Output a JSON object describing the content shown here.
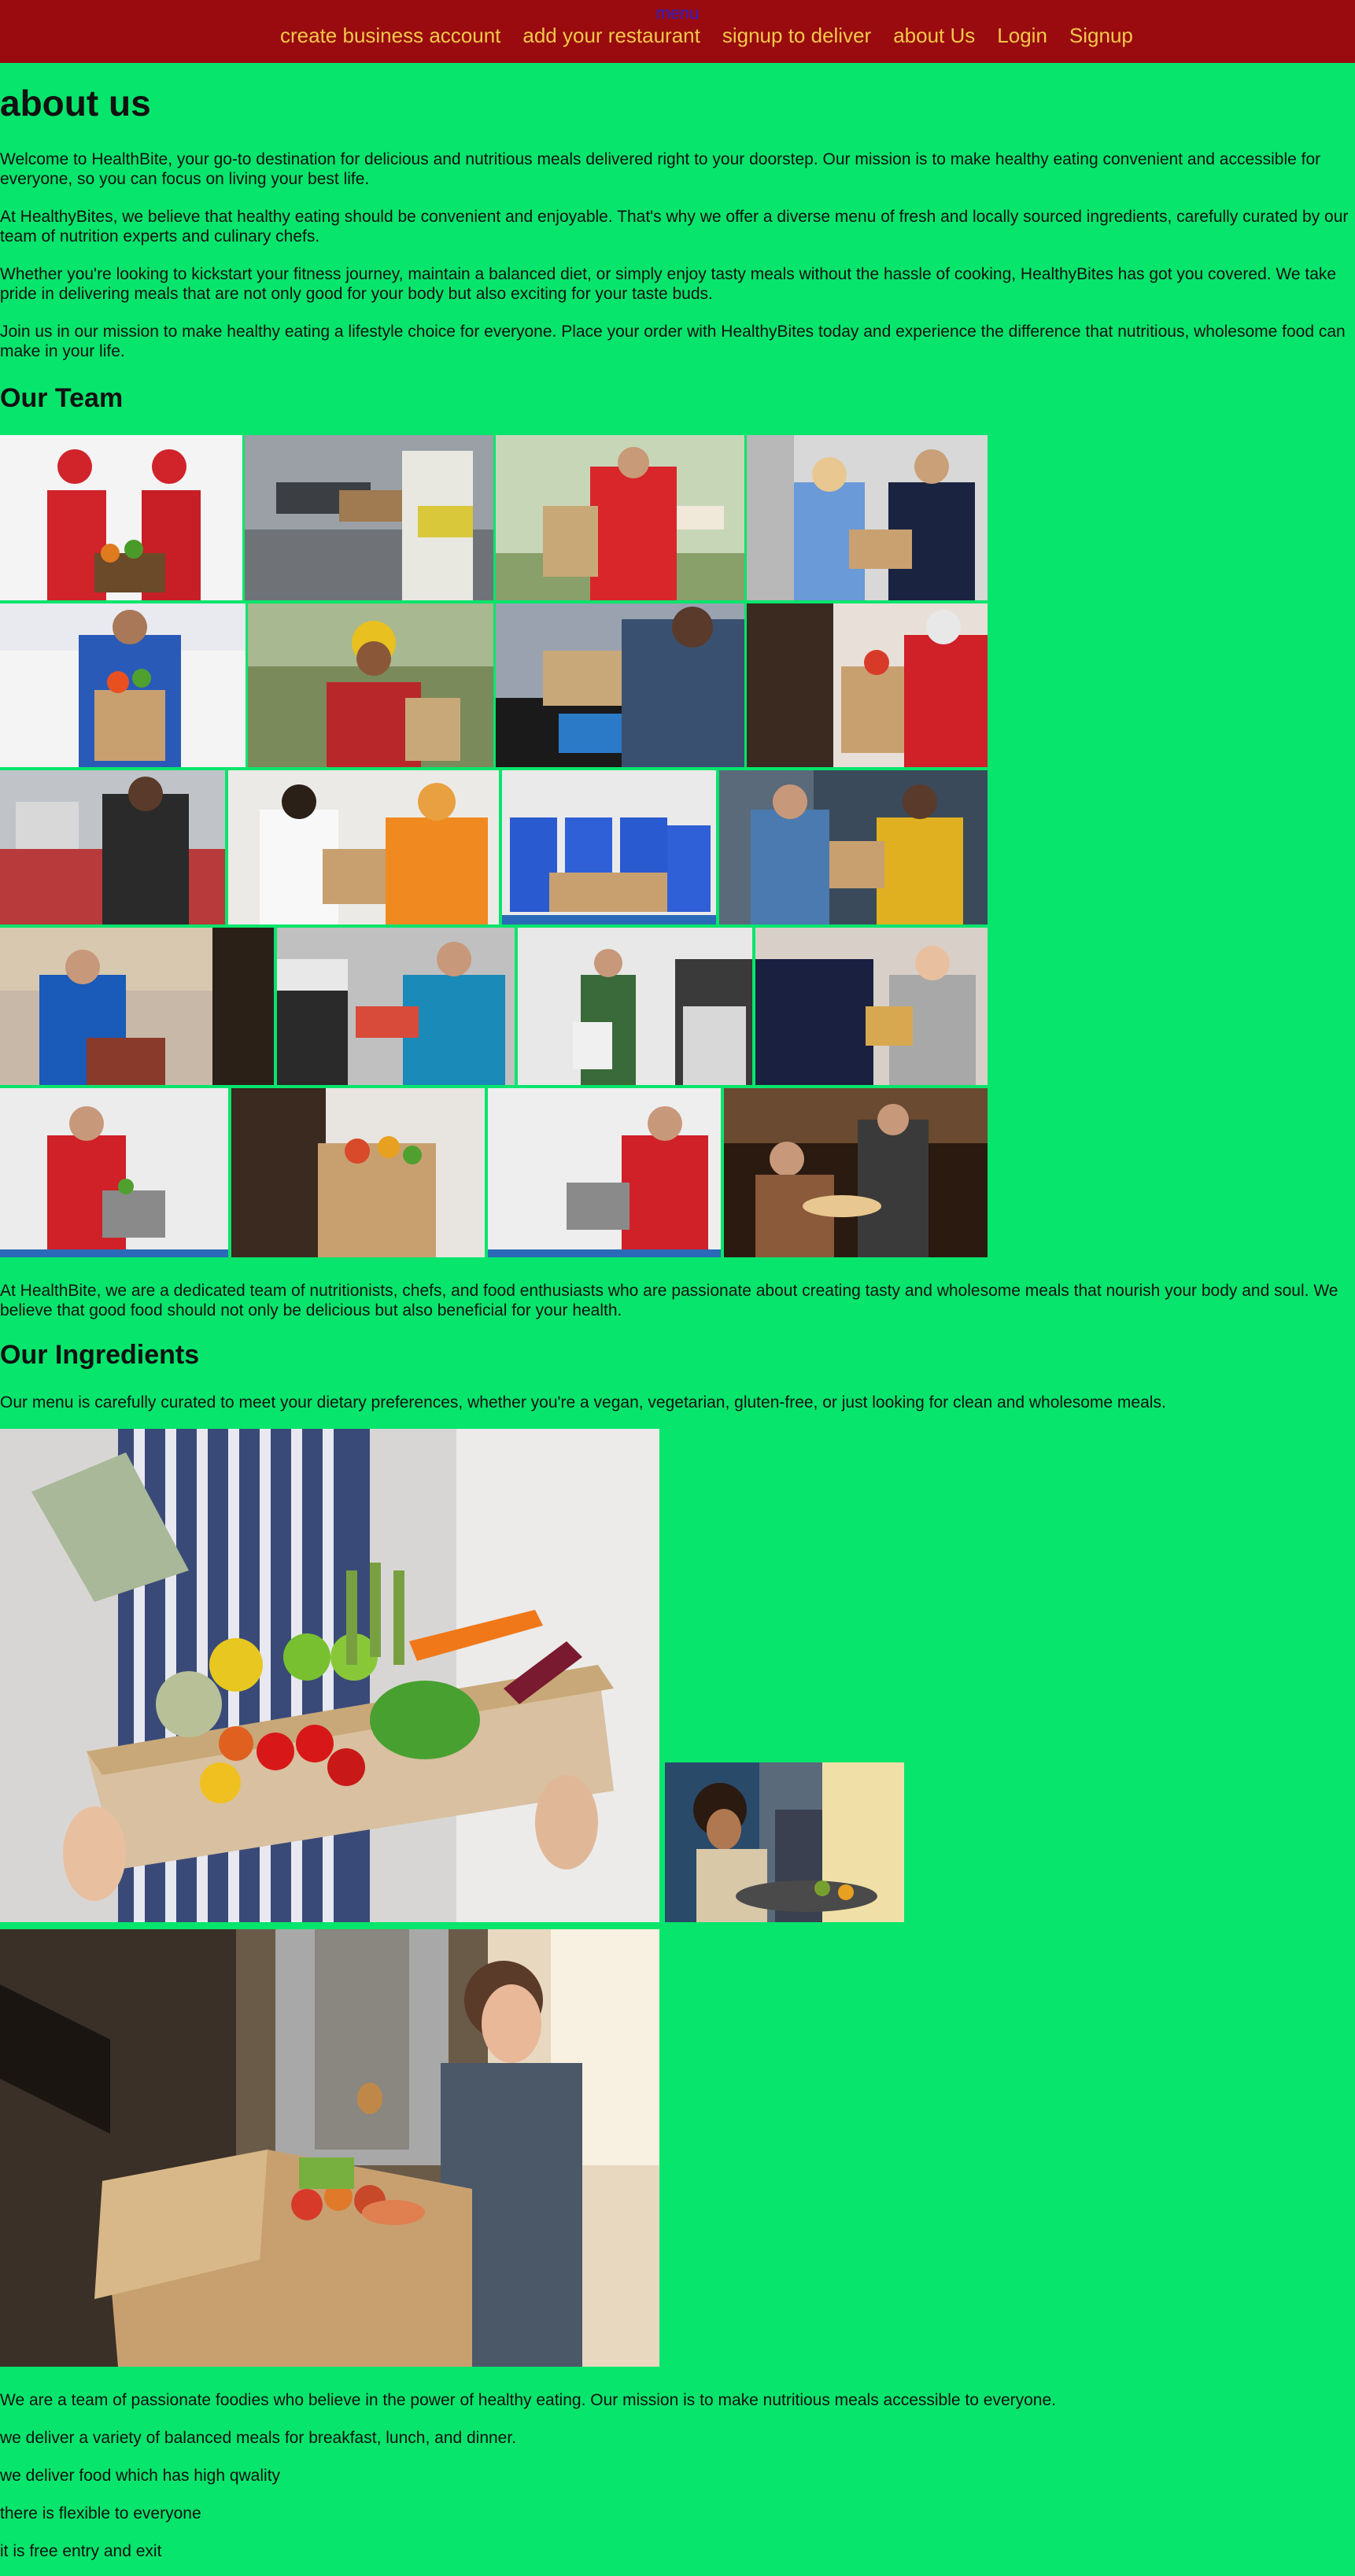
{
  "nav": {
    "menu_label": "menu",
    "items": [
      "create business account",
      "add your restaurant",
      "signup to deliver",
      "about Us",
      "Login",
      "Signup"
    ]
  },
  "about": {
    "title": "about us",
    "paragraphs": [
      "Welcome to HealthBite, your go-to destination for delicious and nutritious meals delivered right to your doorstep. Our mission is to make healthy eating convenient and accessible for everyone, so you can focus on living your best life.",
      "At HealthyBites, we believe that healthy eating should be convenient and enjoyable. That's why we offer a diverse menu of fresh and locally sourced ingredients, carefully curated by our team of nutrition experts and culinary chefs.",
      "Whether you're looking to kickstart your fitness journey, maintain a balanced diet, or simply enjoy tasty meals without the hassle of cooking, HealthyBites has got you covered. We take pride in delivering meals that are not only good for your body but also exciting for your taste buds.",
      "Join us in our mission to make healthy eating a lifestyle choice for everyone. Place your order with HealthyBites today and experience the difference that nutritious, wholesome food can make in your life."
    ]
  },
  "team": {
    "title": "Our Team",
    "description": "At HealthBite, we are a dedicated team of nutritionists, chefs, and food enthusiasts who are passionate about creating tasty and wholesome meals that nourish your body and soul. We believe that good food should not only be delicious but also beneficial for your health."
  },
  "ingredients": {
    "title": "Our Ingredients",
    "intro": "Our menu is carefully curated to meet your dietary preferences, whether you're a vegan, vegetarian, gluten-free, or just looking for clean and wholesome meals."
  },
  "footer_lines": [
    "We are a team of passionate foodies who believe in the power of healthy eating. Our mission is to make nutritious meals accessible to everyone.",
    "we deliver a variety of balanced meals for breakfast, lunch, and dinner.",
    "we deliver food which has high qwality",
    "there is flexible to everyone",
    "it is free entry and exit"
  ],
  "colors": {
    "page_bg": "#07e56c",
    "nav_bg": "#990b0e",
    "nav_link": "#f5c84a",
    "menu_link": "#2b1ecf"
  }
}
